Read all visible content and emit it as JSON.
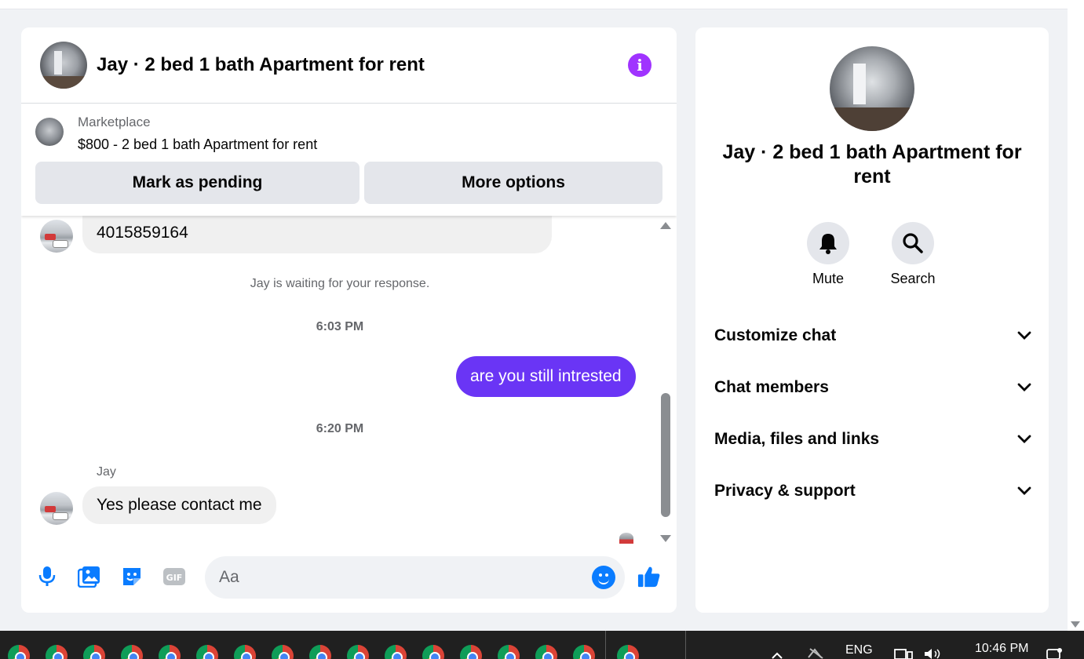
{
  "chat": {
    "header_title": "Jay · 2 bed 1 bath Apartment for rent",
    "info_icon_glyph": "i",
    "marketplace": {
      "label": "Marketplace",
      "price_title": "$800 - 2 bed 1 bath Apartment for rent",
      "mark_pending_label": "Mark as pending",
      "more_options_label": "More options"
    },
    "messages": {
      "partial_in_text": "4015859164",
      "waiting_notice": "Jay is waiting for your response.",
      "timestamp_1": "6:03 PM",
      "out_text": "are you still intrested",
      "timestamp_2": "6:20 PM",
      "sender_name": "Jay",
      "in_text": "Yes please contact me"
    },
    "composer": {
      "placeholder": "Aa",
      "gif_label": "GIF"
    }
  },
  "info_panel": {
    "name": "Jay · 2 bed 1 bath Apartment for rent",
    "mute_label": "Mute",
    "search_label": "Search",
    "sections": [
      {
        "label": "Customize chat"
      },
      {
        "label": "Chat members"
      },
      {
        "label": "Media, files and links"
      },
      {
        "label": "Privacy & support"
      }
    ]
  },
  "taskbar": {
    "language": "ENG",
    "time": "10:46 PM",
    "more_glyph": "..."
  },
  "colors": {
    "accent_purple": "#a033ff",
    "outgoing_bubble": "#6a35f5",
    "messenger_blue": "#0a7cff"
  }
}
